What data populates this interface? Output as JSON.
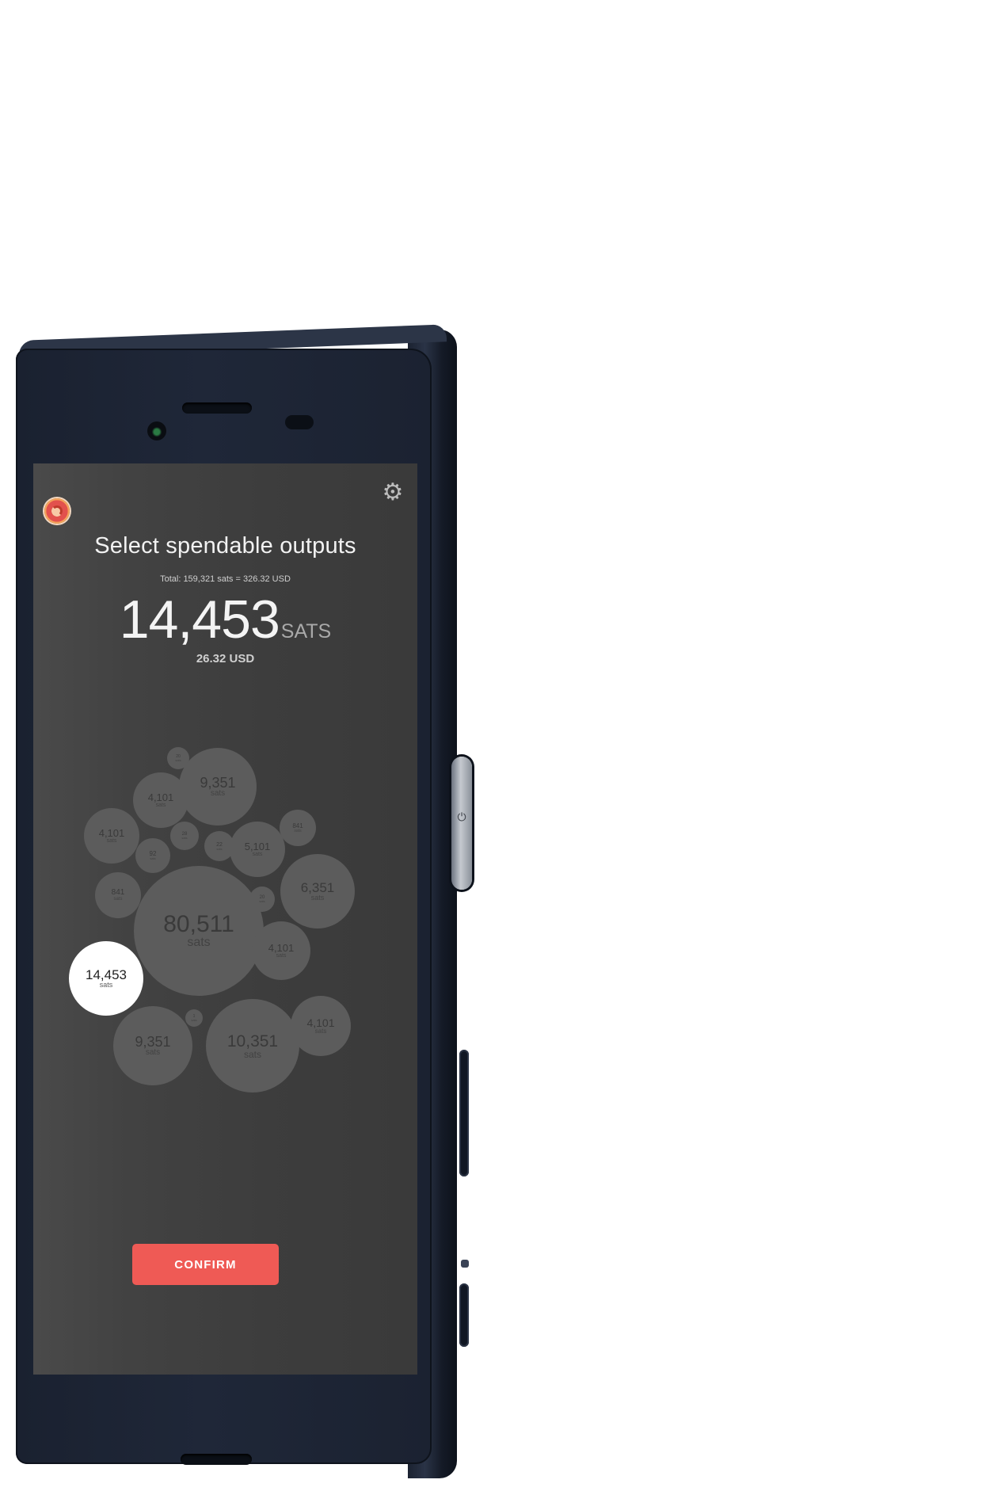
{
  "screen": {
    "title": "Select spendable outputs",
    "subtotal": "Total:  159,321 sats = 326.32 USD",
    "amount": "14,453",
    "amount_unit": "SATS",
    "usd": "26.32 USD",
    "confirm_label": "CONFIRM"
  },
  "bubbles": [
    {
      "value": "20",
      "unit": "sats",
      "selected": false
    },
    {
      "value": "9,351",
      "unit": "sats",
      "selected": false
    },
    {
      "value": "4,101",
      "unit": "sats",
      "selected": false
    },
    {
      "value": "4,101",
      "unit": "sats",
      "selected": false
    },
    {
      "value": "28",
      "unit": "sats",
      "selected": false
    },
    {
      "value": "92",
      "unit": "sats",
      "selected": false
    },
    {
      "value": "22",
      "unit": "sats",
      "selected": false
    },
    {
      "value": "5,101",
      "unit": "sats",
      "selected": false
    },
    {
      "value": "841",
      "unit": "sats",
      "selected": false
    },
    {
      "value": "841",
      "unit": "sats",
      "selected": false
    },
    {
      "value": "6,351",
      "unit": "sats",
      "selected": false
    },
    {
      "value": "80,511",
      "unit": "sats",
      "selected": false
    },
    {
      "value": "20",
      "unit": "sats",
      "selected": false
    },
    {
      "value": "14,453",
      "unit": "sats",
      "selected": true
    },
    {
      "value": "4,101",
      "unit": "sats",
      "selected": false
    },
    {
      "value": "1",
      "unit": "sats",
      "selected": false
    },
    {
      "value": "9,351",
      "unit": "sats",
      "selected": false
    },
    {
      "value": "10,351",
      "unit": "sats",
      "selected": false
    },
    {
      "value": "4,101",
      "unit": "sats",
      "selected": false
    }
  ],
  "colors": {
    "accent": "#ef5a55",
    "screen_bg": "#404040",
    "bubble": "#5c5c5c",
    "bubble_selected": "#ffffff",
    "phone_body": "#1f2738"
  },
  "icons": {
    "settings": "gear-icon",
    "logo": "app-logo"
  }
}
